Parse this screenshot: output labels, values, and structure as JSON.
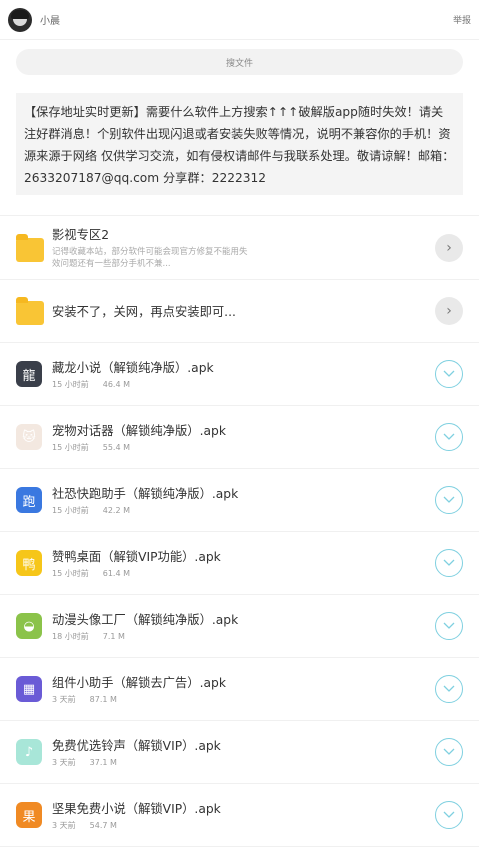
{
  "header": {
    "username": "小晨",
    "report_label": "举报"
  },
  "search": {
    "placeholder": "搜文件"
  },
  "notice": {
    "text": "【保存地址实时更新】需要什么软件上方搜索↑↑↑破解版app随时失效！请关注好群消息！个别软件出现闪退或者安装失败等情况，说明不兼容你的手机！资源来源于网络 仅供学习交流，如有侵权请邮件与我联系处理。敬请谅解！邮箱：2633207187@qq.com 分享群：2222312"
  },
  "folders": [
    {
      "title": "影视专区2",
      "desc": "记得收藏本站，部分软件可能会现官方修复不能用失效问题还有一些部分手机不兼..."
    },
    {
      "title": "安装不了，关网，再点安装即可..."
    }
  ],
  "files": [
    {
      "title": "藏龙小说（解锁纯净版）.apk",
      "time": "15 小时前",
      "size": "46.4 M",
      "icon": "dragon-icon",
      "color": "#3a3f4a",
      "glyph": "龍"
    },
    {
      "title": "宠物对话器（解锁纯净版）.apk",
      "time": "15 小时前",
      "size": "55.4 M",
      "icon": "pet-icon",
      "color": "#f3e8e0",
      "glyph": "🐱"
    },
    {
      "title": "社恐快跑助手（解锁纯净版）.apk",
      "time": "15 小时前",
      "size": "42.2 M",
      "icon": "runner-icon",
      "color": "#3a78e0",
      "glyph": "跑"
    },
    {
      "title": "赞鸭桌面（解锁VIP功能）.apk",
      "time": "15 小时前",
      "size": "61.4 M",
      "icon": "duck-icon",
      "color": "#f6c619",
      "glyph": "鸭"
    },
    {
      "title": "动漫头像工厂（解锁纯净版）.apk",
      "time": "18 小时前",
      "size": "7.1 M",
      "icon": "android-icon",
      "color": "#8bc34a",
      "glyph": "◒"
    },
    {
      "title": "组件小助手（解锁去广告）.apk",
      "time": "3 天前",
      "size": "87.1 M",
      "icon": "widget-icon",
      "color": "#6a5bd6",
      "glyph": "▦"
    },
    {
      "title": "免费优选铃声（解锁VIP）.apk",
      "time": "3 天前",
      "size": "37.1 M",
      "icon": "ringtone-icon",
      "color": "#a8e6d8",
      "glyph": "♪"
    },
    {
      "title": "坚果免费小说（解锁VIP）.apk",
      "time": "3 天前",
      "size": "54.7 M",
      "icon": "nut-icon",
      "color": "#f08a24",
      "glyph": "果"
    }
  ],
  "colors": {
    "accent": "#7fd0e0",
    "folder": "#f9c535"
  }
}
